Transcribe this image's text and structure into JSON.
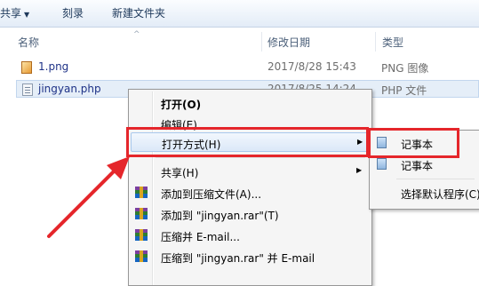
{
  "toolbar": {
    "share_label": "共享",
    "burn_label": "刻录",
    "new_folder_label": "新建文件夹"
  },
  "columns": {
    "name": "名称",
    "date": "修改日期",
    "type": "类型"
  },
  "files": [
    {
      "name": "1.png",
      "date": "2017/8/28 15:43",
      "type": "PNG 图像",
      "icon": "png-file-icon"
    },
    {
      "name": "jingyan.php",
      "date": "2017/8/25 14:24",
      "type": "PHP 文件",
      "icon": "php-file-icon"
    }
  ],
  "context_menu": {
    "items": [
      {
        "label": "打开(O)",
        "bold": true
      },
      {
        "label": "编辑(E)"
      },
      {
        "label": "打开方式(H)",
        "submenu": true,
        "highlighted": true
      },
      {
        "label": "共享(H)",
        "submenu": true
      },
      {
        "label": "添加到压缩文件(A)...",
        "icon": "winrar-icon"
      },
      {
        "label": "添加到 \"jingyan.rar\"(T)",
        "icon": "winrar-icon"
      },
      {
        "label": "压缩并 E-mail...",
        "icon": "winrar-icon"
      },
      {
        "label": "压缩到 \"jingyan.rar\" 并 E-mail",
        "icon": "winrar-icon"
      }
    ]
  },
  "open_with_submenu": {
    "items": [
      {
        "label": "记事本",
        "icon": "notepad-icon"
      },
      {
        "label": "记事本",
        "icon": "notepad-icon"
      },
      {
        "label": "选择默认程序(C)..."
      }
    ]
  },
  "colors": {
    "annotation_red": "#e5262b",
    "link_blue": "#1e3287",
    "selection_bg": "#e5eef8"
  }
}
